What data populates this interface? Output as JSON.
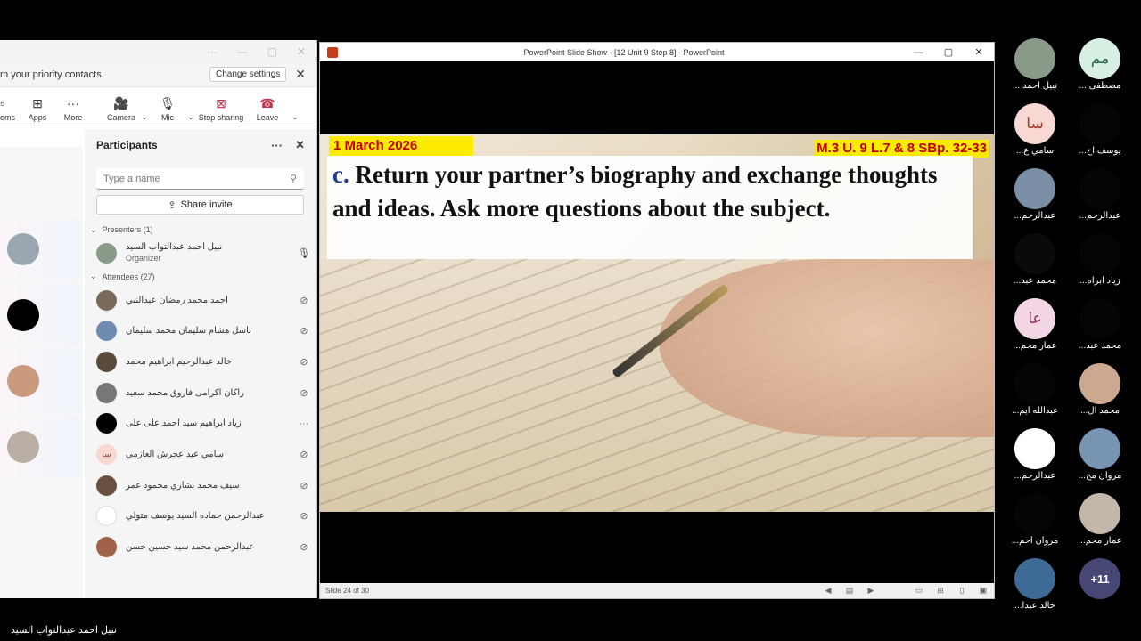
{
  "teams": {
    "banner_text": "m your priority contacts.",
    "change_settings": "Change settings",
    "toolbar": [
      {
        "icon": "rooms-icon",
        "label": "oms"
      },
      {
        "icon": "apps-icon",
        "label": "Apps"
      },
      {
        "icon": "more-icon",
        "label": "More"
      },
      {
        "icon": "camera-off-icon",
        "label": "Camera"
      },
      {
        "icon": "mic-icon",
        "label": "Mic"
      },
      {
        "icon": "stop-sharing-icon",
        "label": "Stop sharing"
      },
      {
        "icon": "leave-icon",
        "label": "Leave"
      }
    ],
    "panel_title": "Participants",
    "search_placeholder": "Type a name",
    "share_invite": "Share invite",
    "presenters_label": "Presenters (1)",
    "attendees_label": "Attendees (27)",
    "presenter": {
      "name": "نبيل احمد عبدالتواب السيد",
      "role": "Organizer"
    },
    "attendees": [
      {
        "name": "احمد محمد رمضان عبدالنبي",
        "mic": "muted"
      },
      {
        "name": "باسل هشام سليمان محمد سليمان",
        "mic": "muted"
      },
      {
        "name": "خالد عبدالرحيم ابراهيم محمد",
        "mic": "muted"
      },
      {
        "name": "راكان اكرامى فاروق محمد سعيد",
        "mic": "muted"
      },
      {
        "name": "زياد ابراهيم سيد احمد على على",
        "mic": "more"
      },
      {
        "name": "سامي عيد عجرش العازمي",
        "mic": "muted",
        "initials": "سا"
      },
      {
        "name": "سيف محمد بشاري محمود عمر",
        "mic": "muted"
      },
      {
        "name": "عبدالرحمن حماده السيد يوسف متولي",
        "mic": "muted"
      },
      {
        "name": "عبدالرحمن محمد سيد حسين حسن",
        "mic": "muted"
      }
    ]
  },
  "ppt": {
    "title": "PowerPoint Slide Show - [12 Unit 9 Step 8] - PowerPoint",
    "date": "1 March 2026",
    "reference": "M.3 U. 9 L.7 & 8 SBp. 32-33",
    "letter": "c.",
    "instruction": "Return your partner’s biography and exchange thoughts and ideas. Ask more questions about the subject.",
    "status": "Slide 24 of 30"
  },
  "gallery": [
    {
      "name": "نبيل احمد ...",
      "initials": "",
      "color": "#8a9a88"
    },
    {
      "name": "مصطفى ...",
      "initials": "مم",
      "color": "#d8f0e4",
      "text": "#2a6a50"
    },
    {
      "name": "سامي ع...",
      "initials": "سا",
      "color": "#f7d8d3",
      "text": "#a03a2a"
    },
    {
      "name": "يوسف اح...",
      "initials": "",
      "color": "#000"
    },
    {
      "name": "عبدالرحم...",
      "initials": "",
      "color": "#7a8ea6"
    },
    {
      "name": "عبدالرحم...",
      "initials": "",
      "color": "#000"
    },
    {
      "name": "محمد عبد...",
      "initials": "",
      "color": "#000"
    },
    {
      "name": "زياد ابراه...",
      "initials": "",
      "color": "#000"
    },
    {
      "name": "عمار محم...",
      "initials": "عا",
      "color": "#f3d6e4",
      "text": "#8a2a5a"
    },
    {
      "name": "محمد عبد...",
      "initials": "",
      "color": "#000"
    },
    {
      "name": "عبدالله ايم...",
      "initials": "",
      "color": "#000"
    },
    {
      "name": "محمد ال...",
      "initials": "",
      "color": "#cda891"
    },
    {
      "name": "عبدالرحم...",
      "initials": "",
      "color": "#fff"
    },
    {
      "name": "مروان مح...",
      "initials": "",
      "color": "#7794b3"
    },
    {
      "name": "مروان احم...",
      "initials": "",
      "color": "#000"
    },
    {
      "name": "عمار محم...",
      "initials": "",
      "color": "#c2b7a8"
    },
    {
      "name": "خالد عبدا...",
      "initials": "",
      "color": "#3d6b95"
    },
    {
      "name": "",
      "initials": "+11",
      "color": "#464775",
      "text": "#fff"
    }
  ],
  "speaker_name": "نبيل احمد عبدالتواب السيد"
}
